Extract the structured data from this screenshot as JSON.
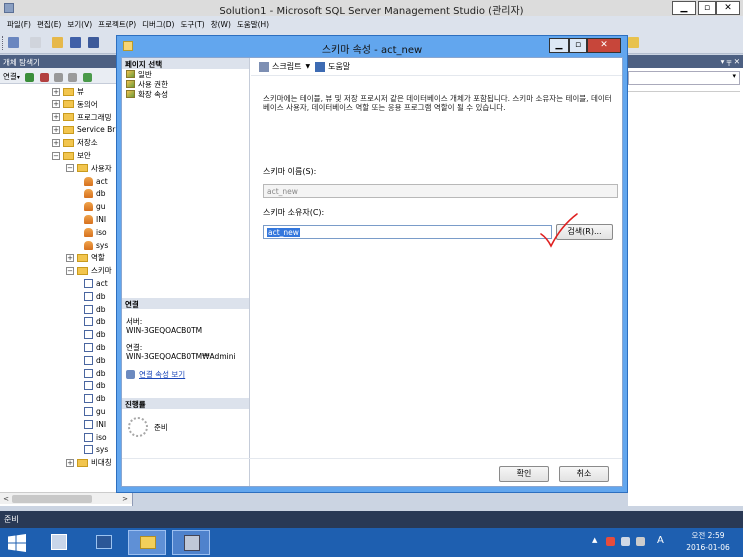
{
  "ssms": {
    "title": "Solution1 - Microsoft SQL Server Management Studio (관리자)",
    "menu": [
      "파일(F)",
      "편집(E)",
      "보기(V)",
      "프로젝트(P)",
      "디버그(D)",
      "도구(T)",
      "창(W)",
      "도움말(H)"
    ],
    "status": "준비"
  },
  "object_explorer": {
    "title": "개체 탐색기",
    "connect_label": "연결",
    "tree": [
      {
        "label": "뷰",
        "icon": "folder-icon",
        "expander": "+"
      },
      {
        "label": "동의어",
        "icon": "folder-icon",
        "expander": "+"
      },
      {
        "label": "프로그래밍",
        "icon": "folder-icon",
        "expander": "+"
      },
      {
        "label": "Service Br",
        "icon": "folder-icon",
        "expander": "+"
      },
      {
        "label": "저장소",
        "icon": "folder-icon",
        "expander": "+"
      },
      {
        "label": "보안",
        "icon": "folder-icon",
        "expander": "−"
      },
      {
        "label": "사용자",
        "icon": "folder-icon",
        "expander": "−"
      },
      {
        "label": "act",
        "icon": "user-icon"
      },
      {
        "label": "db",
        "icon": "user-icon"
      },
      {
        "label": "gu",
        "icon": "user-icon"
      },
      {
        "label": "INI",
        "icon": "user-icon"
      },
      {
        "label": "iso",
        "icon": "user-icon"
      },
      {
        "label": "sys",
        "icon": "user-icon"
      },
      {
        "label": "역할",
        "icon": "folder-icon",
        "expander": "+"
      },
      {
        "label": "스키마",
        "icon": "folder-icon",
        "expander": "−"
      },
      {
        "label": "act",
        "icon": "schema-icon"
      },
      {
        "label": "db",
        "icon": "schema-icon"
      },
      {
        "label": "db",
        "icon": "schema-icon"
      },
      {
        "label": "db",
        "icon": "schema-icon"
      },
      {
        "label": "db",
        "icon": "schema-icon"
      },
      {
        "label": "db",
        "icon": "schema-icon"
      },
      {
        "label": "db",
        "icon": "schema-icon"
      },
      {
        "label": "db",
        "icon": "schema-icon"
      },
      {
        "label": "db",
        "icon": "schema-icon"
      },
      {
        "label": "db",
        "icon": "schema-icon"
      },
      {
        "label": "gu",
        "icon": "schema-icon"
      },
      {
        "label": "INI",
        "icon": "schema-icon"
      },
      {
        "label": "iso",
        "icon": "schema-icon"
      },
      {
        "label": "sys",
        "icon": "schema-icon"
      },
      {
        "label": "비대칭",
        "icon": "folder-icon",
        "expander": "+"
      }
    ]
  },
  "right_panel": {
    "pin": "▾ ╤ ✕"
  },
  "dialog": {
    "title": "스키마 속성 - act_new",
    "page_select_header": "페이지 선택",
    "pages": [
      "일반",
      "사용 권한",
      "확장 속성"
    ],
    "connection_header": "연결",
    "server_label": "서버:",
    "server_value": "WIN-3GEQOACB0TM",
    "connection_label": "연결:",
    "connection_value": "WIN-3GEQOACB0TM₩Admini",
    "connection_link": "연결 속성 보기",
    "progress_header": "진행률",
    "progress_status": "준비",
    "toolbar_script": "스크립트",
    "toolbar_help": "도움말",
    "description": "스키마에는 테이블, 뷰 및 저장 프로시저 같은 데이터베이스 개체가 포함됩니다. 스키마 소유자는 테이블, 데이터베이스 사용자, 데이터베이스 역할 또는 응용 프로그램 역할이 될 수 있습니다.",
    "schema_name_label": "스키마 이름(S):",
    "schema_name_value": "act_new",
    "schema_owner_label": "스키마 소유자(C):",
    "schema_owner_value": "act_new",
    "search_button": "검색(R)...",
    "ok_button": "확인",
    "cancel_button": "취소"
  },
  "taskbar": {
    "time": "오전 2:59",
    "date": "2016-01-06",
    "ime": "A"
  },
  "colors": {
    "dialog_frame": "#62a6ee",
    "annotation": "#e02020",
    "taskbar": "#1e5fb0"
  }
}
